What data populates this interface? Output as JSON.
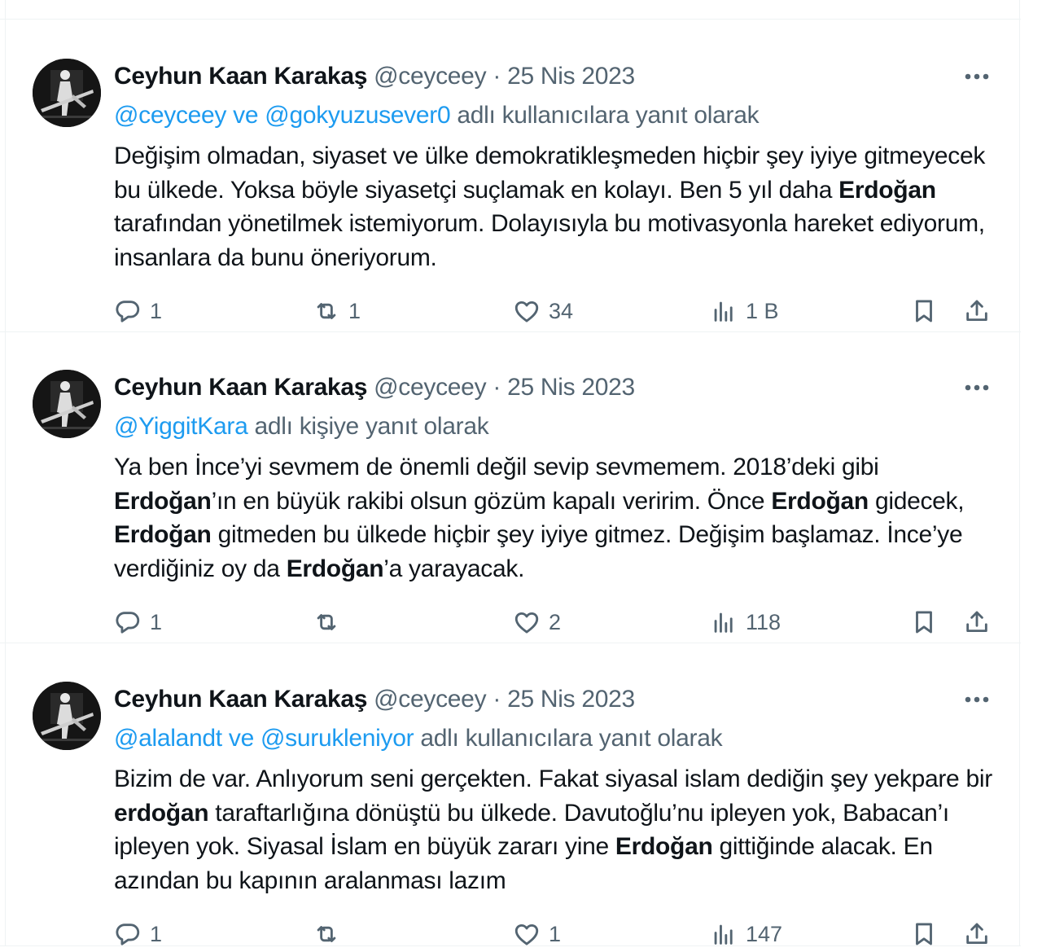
{
  "tweets": [
    {
      "author_name": "Ceyhun Kaan Karakaş",
      "handle": "@ceyceey",
      "separator": "·",
      "date": "25 Nis 2023",
      "mention_1": "@ceyceey",
      "joiner": "ve",
      "mention_2": "@gokyuzusever0",
      "reply_suffix": "adlı kullanıcılara yanıt olarak",
      "body_html": "Değişim olmadan, siyaset ve ülke demokratikleşmeden hiçbir şey iyiye gitmeyecek bu ülkede. Yoksa böyle siyasetçi suçlamak en kolayı. Ben 5 yıl daha <b>Erdoğan</b> tarafından yönetilmek istemiyorum. Dolayısıyla bu motivasyonla hareket ediyorum, insanlara da bunu öneriyorum.",
      "replies": "1",
      "retweets": "1",
      "likes": "34",
      "views": "1 B"
    },
    {
      "author_name": "Ceyhun Kaan Karakaş",
      "handle": "@ceyceey",
      "separator": "·",
      "date": "25 Nis 2023",
      "mention_1": "@YiggitKara",
      "joiner": "",
      "mention_2": "",
      "reply_suffix": "adlı kişiye yanıt olarak",
      "body_html": "Ya ben İnce’yi sevmem de önemli değil sevip sevmemem. 2018’deki gibi <b>Erdoğan</b>’ın en büyük rakibi olsun gözüm kapalı veririm. Önce <b>Erdoğan</b> gidecek, <b>Erdoğan</b> gitmeden bu ülkede hiçbir şey iyiye gitmez. Değişim başlamaz. İnce’ye verdiğiniz oy da <b>Erdoğan</b>’a yarayacak.",
      "replies": "1",
      "retweets": "",
      "likes": "2",
      "views": "118"
    },
    {
      "author_name": "Ceyhun Kaan Karakaş",
      "handle": "@ceyceey",
      "separator": "·",
      "date": "25 Nis 2023",
      "mention_1": "@alalandt",
      "joiner": "ve",
      "mention_2": "@surukleniyor",
      "reply_suffix": "adlı kullanıcılara yanıt olarak",
      "body_html": "Bizim de var. Anlıyorum seni gerçekten. Fakat siyasal islam dediğin şey yekpare bir <b>erdoğan</b> taraftarlığına dönüştü bu ülkede. Davutoğlu’nu ipleyen yok, Babacan’ı ipleyen yok. Siyasal İslam en büyük zararı yine <b>Erdoğan</b> gittiğinde alacak. En azından bu kapının aralanması lazım",
      "replies": "1",
      "retweets": "",
      "likes": "1",
      "views": "147"
    }
  ],
  "icons": {
    "reply": "reply-bubble-icon",
    "retweet": "retweet-icon",
    "like": "heart-icon",
    "views": "views-bar-chart-icon",
    "bookmark": "bookmark-icon",
    "share": "share-upload-icon",
    "more": "more-dots-icon"
  },
  "colors": {
    "link": "#1d9bf0",
    "muted": "#536471",
    "text": "#0f1419",
    "border": "#eff3f4"
  }
}
